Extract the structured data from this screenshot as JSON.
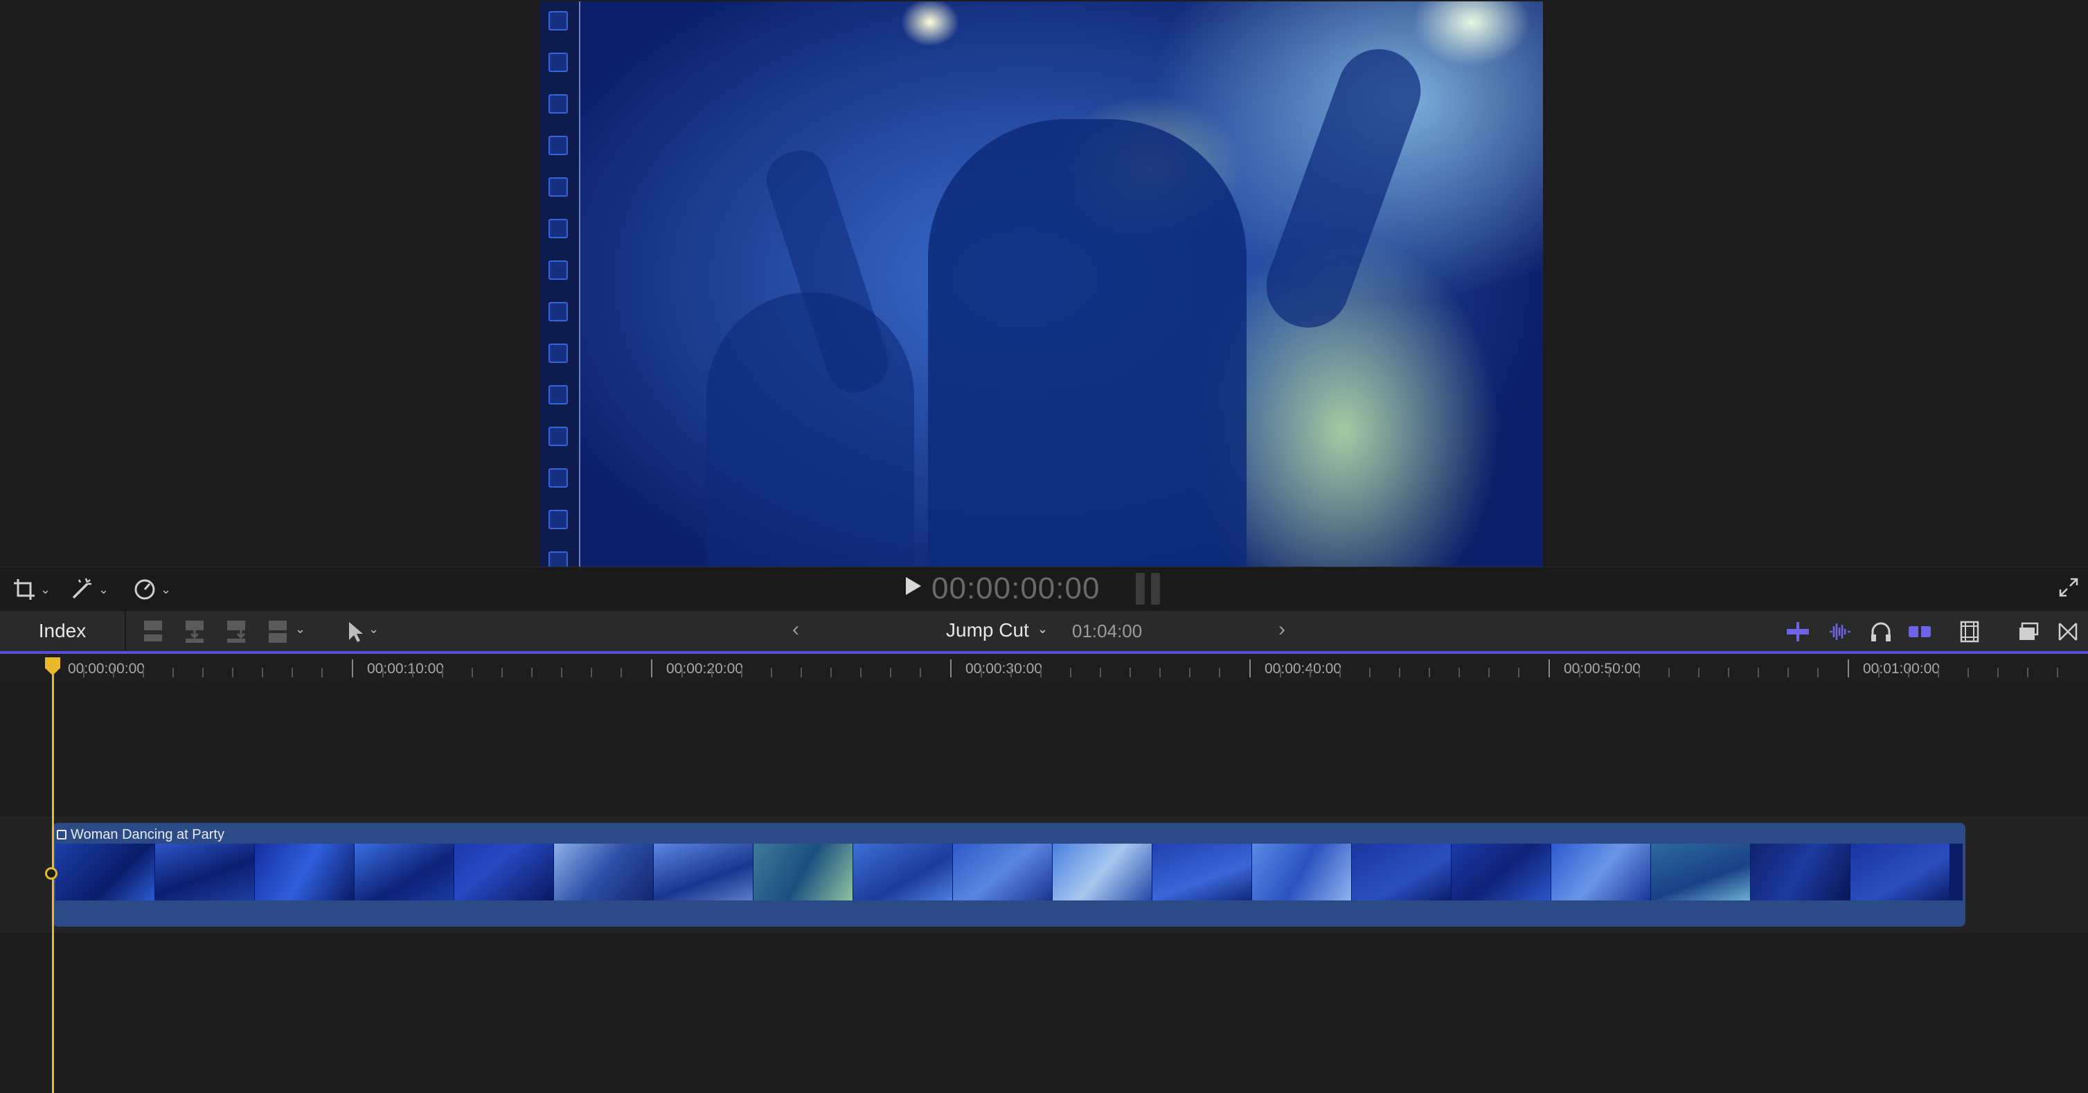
{
  "viewer": {
    "timecode": "00:00:00:00",
    "play_icon": "play-icon",
    "fullscreen_icon": "fullscreen-icon"
  },
  "toolbar": {
    "crop_icon": "crop-icon",
    "enhance_icon": "magic-wand-icon",
    "retime_icon": "speedometer-icon"
  },
  "timeline_header": {
    "index_label": "Index",
    "project_name": "Jump Cut",
    "project_duration": "01:04:00",
    "accent": "#5b4fd8"
  },
  "ruler": {
    "labels": [
      "00:00:00:00",
      "00:00:10:00",
      "00:00:20:00",
      "00:00:30:00",
      "00:00:40:00",
      "00:00:50:00",
      "00:01:00:00"
    ]
  },
  "clip": {
    "title": "Woman Dancing at Party",
    "color": "#2c4a86"
  },
  "playhead": {
    "color": "#e8b92a"
  }
}
